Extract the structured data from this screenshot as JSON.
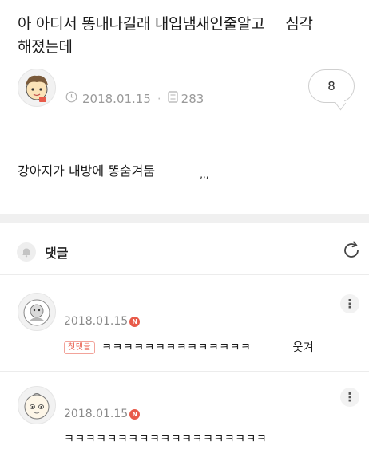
{
  "post": {
    "title_line1": "아 아디서 똥내나길래 내입냄새인줄알고",
    "title_line1_tail": "심각",
    "title_line2": "해졌는데",
    "date": "2018.01.15",
    "views": "283",
    "comment_count": "8",
    "body": "강아지가 내방에 똥숨겨둠",
    "body_tail": ",,,"
  },
  "comments_section": {
    "title": "댓글"
  },
  "comments": [
    {
      "date": "2018.01.15",
      "new_badge": "N",
      "first_badge": "첫댓글",
      "text": "ㅋㅋㅋㅋㅋㅋㅋㅋㅋㅋㅋㅋㅋㅋ",
      "text_tail": "웃겨"
    },
    {
      "date": "2018.01.15",
      "new_badge": "N",
      "text": "ㅋㅋㅋㅋㅋㅋㅋㅋㅋㅋㅋㅋㅋㅋㅋㅋㅋㅋㅋ"
    }
  ],
  "icons": {
    "clock": "clock-icon",
    "views": "document-icon",
    "bell": "bell-icon",
    "refresh": "refresh-icon",
    "kebab": "more-vertical-icon"
  },
  "colors": {
    "accent": "#e85b4a",
    "meta_gray": "#9a9a9a",
    "section_bg": "#f0f0f0"
  }
}
